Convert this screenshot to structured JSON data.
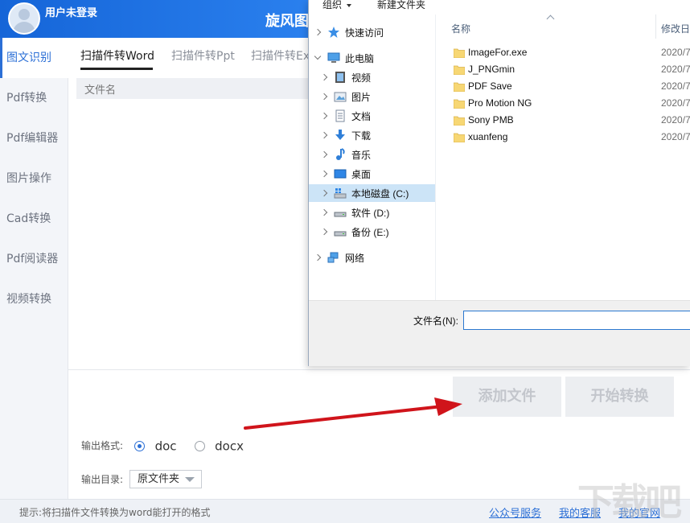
{
  "app": {
    "title": "旋风图",
    "user_status": "用户未登录"
  },
  "sidebar": {
    "items": [
      {
        "label": "图文识别"
      },
      {
        "label": "Pdf转换"
      },
      {
        "label": "Pdf编辑器"
      },
      {
        "label": "图片操作"
      },
      {
        "label": "Cad转换"
      },
      {
        "label": "Pdf阅读器"
      },
      {
        "label": "视频转换"
      }
    ],
    "active_index": 0
  },
  "tabs": [
    {
      "label": "扫描件转Word"
    },
    {
      "label": "扫描件转Ppt"
    },
    {
      "label": "扫描件转Ex"
    }
  ],
  "file_table": {
    "column_name": "文件名"
  },
  "actions": {
    "add_file": "添加文件",
    "start_convert": "开始转换"
  },
  "output_format": {
    "label": "输出格式:",
    "options": [
      "doc",
      "docx"
    ],
    "selected": "doc"
  },
  "output_dir": {
    "label": "输出目录:",
    "value": "原文件夹"
  },
  "footer": {
    "tip": "提示:将扫描件文件转换为word能打开的格式",
    "links": [
      "公众号服务",
      "我的客服",
      "我的官网"
    ]
  },
  "watermark": "下载吧",
  "dialog": {
    "toolbar": {
      "organize": "组织",
      "new_folder": "新建文件夹"
    },
    "nav": {
      "quick_access": "快速访问",
      "this_pc": "此电脑",
      "videos": "视频",
      "pictures": "图片",
      "documents": "文档",
      "downloads": "下载",
      "music": "音乐",
      "desktop": "桌面",
      "local_disk_c": "本地磁盘 (C:)",
      "drive_d": "软件 (D:)",
      "drive_e": "备份 (E:)",
      "network": "网络"
    },
    "columns": {
      "name": "名称",
      "date": "修改日"
    },
    "files": [
      {
        "name": "ImageFor.exe",
        "date": "2020/7"
      },
      {
        "name": "J_PNGmin",
        "date": "2020/7"
      },
      {
        "name": "PDF Save",
        "date": "2020/7"
      },
      {
        "name": "Pro Motion NG",
        "date": "2020/7"
      },
      {
        "name": "Sony PMB",
        "date": "2020/7"
      },
      {
        "name": "xuanfeng",
        "date": "2020/7"
      }
    ],
    "filename_label": "文件名(N):",
    "filename_value": ""
  },
  "colors": {
    "brand_blue": "#2b6fd6",
    "header_gradient_start": "#1565d8",
    "arrow_red": "#d0141b",
    "folder_yellow": "#f7d774",
    "selected_tree": "#cce4f7"
  }
}
